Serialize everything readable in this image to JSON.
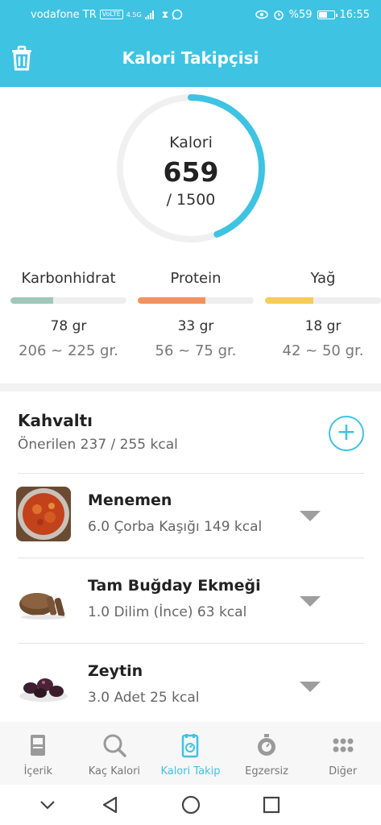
{
  "status_bar": {
    "carrier": "vodafone TR",
    "network_badge": "VoLTE",
    "network_type": "4.5G",
    "battery_text": "%59",
    "battery_level": 0.59,
    "time": "16:55"
  },
  "app_bar": {
    "title": "Kalori Takipçisi",
    "trash_icon": "trash-icon"
  },
  "calories": {
    "label": "Kalori",
    "consumed": "659",
    "goal": "/ 1500",
    "progress": 0.44,
    "ring_color": "#3ec3e3"
  },
  "macros": [
    {
      "name": "Karbonhidrat",
      "amount": "78 gr",
      "range": "206 ~ 225 gr.",
      "progress": 0.37,
      "color": "#9fc7ba"
    },
    {
      "name": "Protein",
      "amount": "33 gr",
      "range": "56 ~ 75 gr.",
      "progress": 0.58,
      "color": "#f2925f"
    },
    {
      "name": "Yağ",
      "amount": "18 gr",
      "range": "42 ~ 50 gr.",
      "progress": 0.42,
      "color": "#f7cc58"
    }
  ],
  "meal": {
    "title": "Kahvaltı",
    "summary": "Önerilen 237 / 255 kcal",
    "add_icon": "plus-circle-icon",
    "items": [
      {
        "name": "Menemen",
        "detail": "6.0 Çorba Kaşığı 149 kcal",
        "image": "menemen-image"
      },
      {
        "name": "Tam Buğday Ekmeği",
        "detail": "1.0 Dilim (İnce) 63 kcal",
        "image": "bread-image"
      },
      {
        "name": "Zeytin",
        "detail": "3.0 Adet 25 kcal",
        "image": "olives-image"
      }
    ]
  },
  "bottom_nav": [
    {
      "label": "İçerik",
      "icon": "book-icon"
    },
    {
      "label": "Kaç Kalori",
      "icon": "search-icon"
    },
    {
      "label": "Kalori Takip",
      "icon": "tracker-icon"
    },
    {
      "label": "Egzersiz",
      "icon": "stopwatch-icon"
    },
    {
      "label": "Diğer",
      "icon": "grid-dots-icon"
    }
  ],
  "active_tab": "Kalori Takip",
  "colors": {
    "accent": "#3ec3e3",
    "inactive": "#777777"
  }
}
